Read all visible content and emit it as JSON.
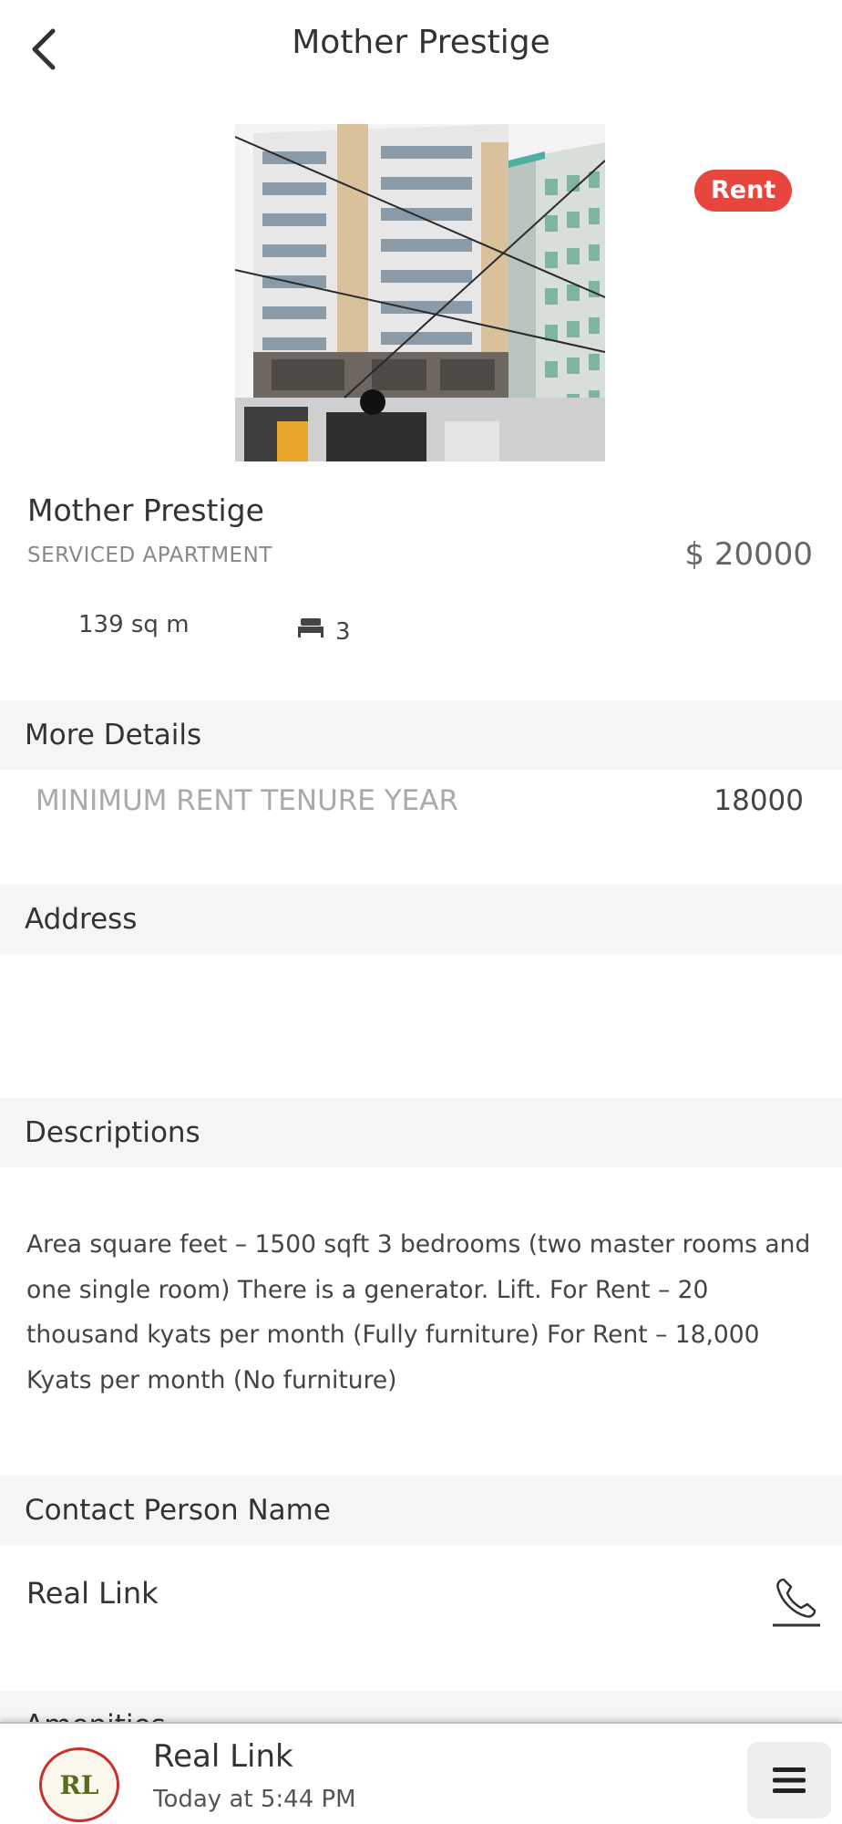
{
  "header": {
    "back_icon": "chevron-left-icon",
    "title": "Mother Prestige"
  },
  "listing": {
    "badge": "Rent",
    "badge_color": "#e8453c",
    "name": "Mother Prestige",
    "type": "SERVICED APARTMENT",
    "price": "$ 20000",
    "area": "139 sq m",
    "bed_icon": "bed-icon",
    "bedrooms": "3"
  },
  "sections": {
    "more_details": "More Details",
    "address": "Address",
    "descriptions": "Descriptions",
    "contact": "Contact Person Name",
    "amenities": "Amenities"
  },
  "details": {
    "label": "MINIMUM RENT TENURE YEAR",
    "value": "18000"
  },
  "description": "Area square feet – 1500 sqft 3 bedrooms (two master rooms and one single room) There is a generator. Lift. For Rent – 20 thousand kyats per month (Fully furniture) For Rent – 18,000 Kyats per month (No furniture)",
  "contact": {
    "name": "Real Link",
    "phone_icon": "phone-icon"
  },
  "bottom_bar": {
    "logo_text": "RL",
    "title": "Real Link",
    "time": "Today at 5:44 PM",
    "menu_icon": "hamburger-menu-icon"
  }
}
